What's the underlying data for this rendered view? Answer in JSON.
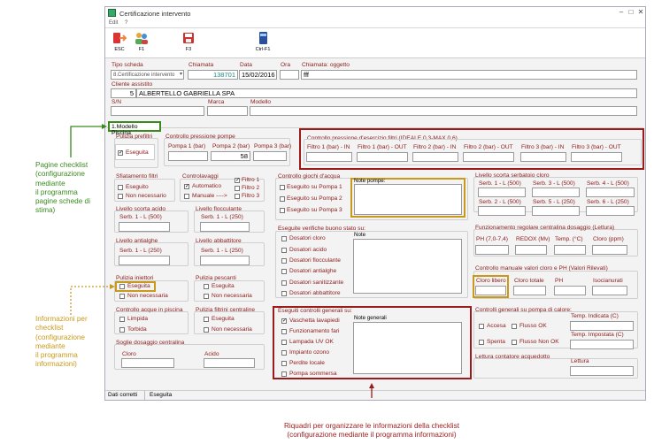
{
  "window": {
    "title": "Certificazione intervento",
    "menu": [
      "Edit",
      "?"
    ]
  },
  "toolbar": {
    "buttons": [
      {
        "label": "ESC",
        "icon": "exit-icon"
      },
      {
        "label": "F1",
        "icon": "add-people-icon"
      },
      {
        "label": "F3",
        "icon": "floppy-save-icon"
      },
      {
        "label": "Ctrl-F1",
        "icon": "book-icon"
      }
    ]
  },
  "header": {
    "tipo_scheda_label": "Tipo scheda",
    "tipo_scheda_value": "8.Certificazione intervento",
    "chiamata_label": "Chiamata",
    "chiamata_value": "138701",
    "data_label": "Data",
    "data_value": "15/02/2016",
    "ora_label": "Ora",
    "chiamata_oggetto_label": "Chiamata: oggetto",
    "chiamata_oggetto_value": "fff",
    "cliente_label": "Cliente assistito",
    "cliente_code": "5",
    "cliente_name": "ALBERTELLO GABRIELLA SPA",
    "sn_label": "S/N",
    "marca_label": "Marca",
    "modello_label": "Modello"
  },
  "tab": {
    "label": "1.Modello Piscina"
  },
  "pulizia_prefiltri": {
    "title": "Pulizia prefiltri",
    "check": "Eseguita"
  },
  "controllo_pressione_pompe": {
    "title": "Controllo pressione pompe",
    "fields": [
      "Pompa 1 (bar)",
      "Pompa 2 (bar)",
      "Pompa 3 (bar)"
    ],
    "pompa2_value": "58"
  },
  "controllo_filtri": {
    "title": "Controllo pressione d'esercizio filtri (IDEALE 0,3-MAX 0,6)",
    "fields": [
      "Filtro 1 (bar) - IN",
      "Filtro 1 (bar) - OUT",
      "Filtro 2 (bar) - IN",
      "Filtro 2 (bar) - OUT",
      "Filtro 3 (bar) - IN",
      "Filtro 3 (bar) - OUT"
    ]
  },
  "sfiatamento": {
    "title": "Sfiatamento filtri",
    "checks": [
      "Eseguito",
      "Non necessario"
    ]
  },
  "controlavaggi": {
    "title": "Controlavaggi",
    "checks": [
      "Automatico",
      "Manuale ---->"
    ],
    "filtri": [
      "Filtro 1",
      "Filtro 2",
      "Filtro 3"
    ]
  },
  "giochi_acqua": {
    "title": "Controllo giochi d'acqua",
    "checks": [
      "Eseguito su Pompa 1",
      "Eseguito su Pompa 2",
      "Eseguito su Pompa 3"
    ],
    "note_label": "Note pompe:"
  },
  "livello_serbatoio": {
    "title": "Livello scorta serbatoio cloro",
    "fields": [
      "Serb. 1 - L (500)",
      "Serb. 3 - L (500)",
      "Serb. 4 - L (500)",
      "Serb. 2 - L (500)",
      "Serb. 5 - L (250)",
      "Serb. 6 - L (250)"
    ]
  },
  "scorta_acido": {
    "title": "Livello scorta acido",
    "field": "Serb. 1 - L (500)"
  },
  "flocculante": {
    "title": "Livello flocculante",
    "field": "Serb. 1 - L (250)"
  },
  "antialghe": {
    "title": "Livello antialghe",
    "field": "Serb. 1 - L (250)"
  },
  "abbattitore": {
    "title": "Livello abbattitore",
    "field": "Serb. 1 - L (250)"
  },
  "verifiche": {
    "title": "Eseguite verifiche buono stato su:",
    "checks": [
      "Dosatori cloro",
      "Dosatori acido",
      "Dosatori flocculante",
      "Dosatori antialghe",
      "Dosatori sanitizzante",
      "Dosatori abbattitore"
    ],
    "note_label": "Note"
  },
  "centralina": {
    "title": "Funzionamento regolare centralina dosaggio (Lettura)",
    "fields": [
      "PH (7,0-7,4)",
      "REDOX (Mv)",
      "Temp. (°C)",
      "Cloro (ppm)"
    ]
  },
  "pulizia_iniettori": {
    "title": "Pulizia iniettori",
    "checks": [
      "Eseguita",
      "Non necessaria"
    ]
  },
  "pulizia_pescanti": {
    "title": "Pulizia pescanti",
    "checks": [
      "Eseguita",
      "Non necessaria"
    ]
  },
  "controllo_manuale": {
    "title": "Controllo manuale valori cloro e PH (Valori Rilevati)",
    "fields": [
      "Cloro libero",
      "Cloro totale",
      "PH",
      "Isocianurati"
    ]
  },
  "acque_piscina": {
    "title": "Controllo acque in piscina",
    "checks": [
      "Limpida",
      "Torbida"
    ]
  },
  "filtrini": {
    "title": "Pulizia filtrini centraline",
    "checks": [
      "Eseguita",
      "Non necessaria"
    ]
  },
  "controlli_generali": {
    "title": "Eseguiti controlli generali su:",
    "checks": [
      "Vaschetta lavapiedi",
      "Funzionamento fari",
      "Lampada UV OK",
      "Impianto ozono",
      "Perdite locale",
      "Pompa sommersa"
    ],
    "note_label": "Note generali"
  },
  "pompa_calore": {
    "title": "Controlli generali su pompa di calore:",
    "checks": [
      "Accesa",
      "Flusso OK",
      "Spenta",
      "Flusso Non OK"
    ],
    "temp_indicata": "Temp. Indicata (C)",
    "temp_impostata": "Temp. Impostata (C)"
  },
  "soglie": {
    "title": "Soglie dosaggio centralina",
    "fields": [
      "Cloro",
      "Acido"
    ]
  },
  "contatore": {
    "title": "Lettura contatore acquedotto",
    "field": "Lettura"
  },
  "status": {
    "left": "Dati corretti",
    "right": "Eseguita"
  },
  "annotations": {
    "a1": [
      "Pagine checklist",
      "(configurazione",
      "mediante",
      "il programma",
      "pagine schede di",
      "stima)"
    ],
    "a2": [
      "Informazioni per",
      "checklist",
      "(configurazione",
      "mediante",
      "il programma",
      "informazioni)"
    ],
    "a3": [
      "Riquadri per organizzare le informazioni della checklist",
      "(configurazione mediante il programma informazioni)"
    ]
  },
  "colors": {
    "green": "#3a8a1e",
    "orange": "#c99a1a",
    "red": "#9b1a1a",
    "label": "#8b1a1a"
  }
}
